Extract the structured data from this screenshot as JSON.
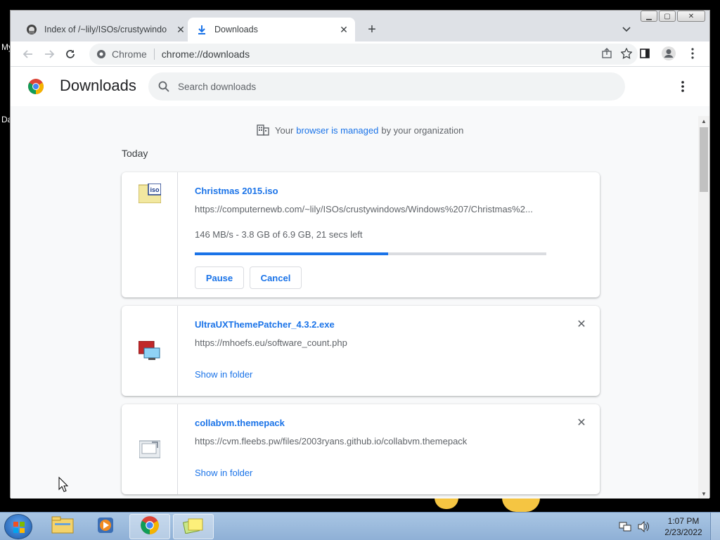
{
  "desktop": {
    "fragments": [
      "My",
      "Da"
    ]
  },
  "tabs": [
    {
      "title": "Index of /~lily/ISOs/crustywindo",
      "icon": "folder-tab-icon",
      "active": false
    },
    {
      "title": "Downloads",
      "icon": "download-icon",
      "active": true
    }
  ],
  "toolbar": {
    "site_label": "Chrome",
    "url": "chrome://downloads"
  },
  "page": {
    "title": "Downloads",
    "search_placeholder": "Search downloads",
    "managed_prefix": "Your",
    "managed_link": "browser is managed",
    "managed_suffix": "by your organization",
    "section_label": "Today"
  },
  "downloads": [
    {
      "name": "Christmas 2015.iso",
      "url": "https://computernewb.com/~lily/ISOs/crustywindows/Windows%207/Christmas%2...",
      "status": "146 MB/s - 3.8 GB of 6.9 GB, 21 secs left",
      "progress_percent": 55,
      "buttons": [
        "Pause",
        "Cancel"
      ],
      "icon": "iso-file-icon"
    },
    {
      "name": "UltraUXThemePatcher_4.3.2.exe",
      "url": "https://mhoefs.eu/software_count.php",
      "link": "Show in folder",
      "icon": "exe-file-icon"
    },
    {
      "name": "collabvm.themepack",
      "url": "https://cvm.fleebs.pw/files/2003ryans.github.io/collabvm.themepack",
      "link": "Show in folder",
      "icon": "themepack-file-icon"
    }
  ],
  "taskbar": {
    "items": [
      "explorer",
      "media-player",
      "chrome",
      "sticky-notes"
    ],
    "time": "1:07 PM",
    "date": "2/23/2022"
  },
  "colors": {
    "accent": "#1a73e8",
    "page_bg": "#f8f9fa",
    "tabstrip_bg": "#dee1e6"
  }
}
